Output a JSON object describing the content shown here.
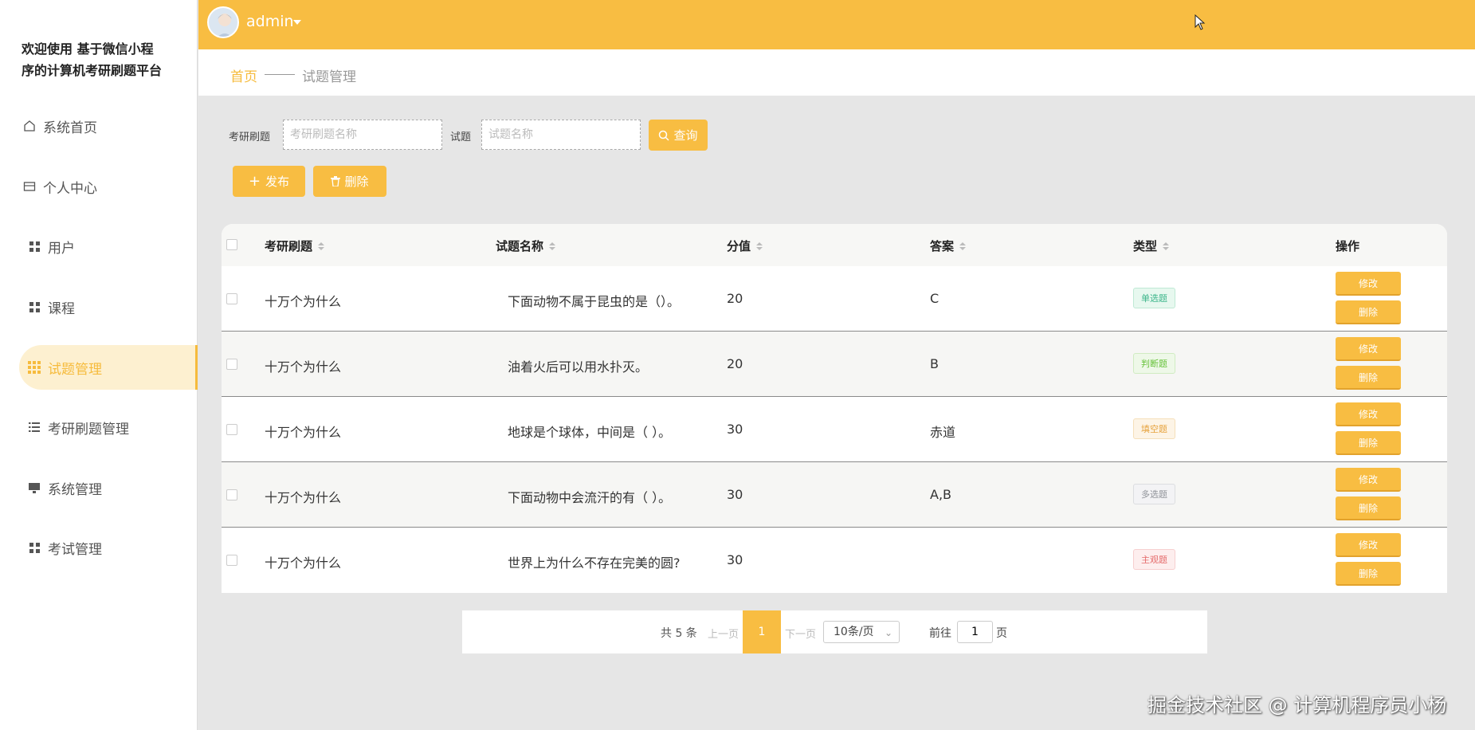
{
  "brand": {
    "line1": "欢迎使用 基于微信小程",
    "line2": "序的计算机考研刷题平台"
  },
  "sidebar": {
    "items": [
      {
        "label": "系统首页",
        "icon": "home-icon"
      },
      {
        "label": "个人中心",
        "icon": "id-card-icon"
      },
      {
        "label": "用户",
        "icon": "grid-icon"
      },
      {
        "label": "课程",
        "icon": "grid-icon"
      },
      {
        "label": "试题管理",
        "icon": "grid9-icon",
        "active": true
      },
      {
        "label": "考研刷题管理",
        "icon": "list-icon"
      },
      {
        "label": "系统管理",
        "icon": "monitor-icon"
      },
      {
        "label": "考试管理",
        "icon": "grid-icon"
      }
    ]
  },
  "header": {
    "username": "admin",
    "accent": "#f8bd42"
  },
  "breadcrumb": {
    "home": "首页",
    "current": "试题管理"
  },
  "search": {
    "label1": "考研刷题",
    "placeholder1": "考研刷题名称",
    "label2": "试题",
    "placeholder2": "试题名称",
    "query_label": "查询"
  },
  "toolbar": {
    "publish_label": "发布",
    "delete_label": "删除"
  },
  "table": {
    "headers": [
      "考研刷题",
      "试题名称",
      "分值",
      "答案",
      "类型",
      "操作"
    ],
    "rows": [
      {
        "topic": "十万个为什么",
        "question": "下面动物不属于昆虫的是（）。",
        "score": "20",
        "answer": "C",
        "type": "单选题"
      },
      {
        "topic": "十万个为什么",
        "question": "油着火后可以用水扑灭。",
        "score": "20",
        "answer": "B",
        "type": "判断题"
      },
      {
        "topic": "十万个为什么",
        "question": "地球是个球体，中间是（ ）。",
        "score": "30",
        "answer": "赤道",
        "type": "填空题"
      },
      {
        "topic": "十万个为什么",
        "question": "下面动物中会流汗的有（ ）。",
        "score": "30",
        "answer": "A,B",
        "type": "多选题"
      },
      {
        "topic": "十万个为什么",
        "question": "世界上为什么不存在完美的圆?",
        "score": "30",
        "answer": "",
        "type": "主观题"
      }
    ],
    "edit_label": "修改",
    "delete_label": "删除"
  },
  "pagination": {
    "total": "共 5 条",
    "prev": "上一页",
    "current": "1",
    "next": "下一页",
    "page_size": "10条/页",
    "goto": "前往",
    "goto_value": "1",
    "page_suffix": "页"
  },
  "watermark": "掘金技术社区 @ 计算机程序员小杨"
}
